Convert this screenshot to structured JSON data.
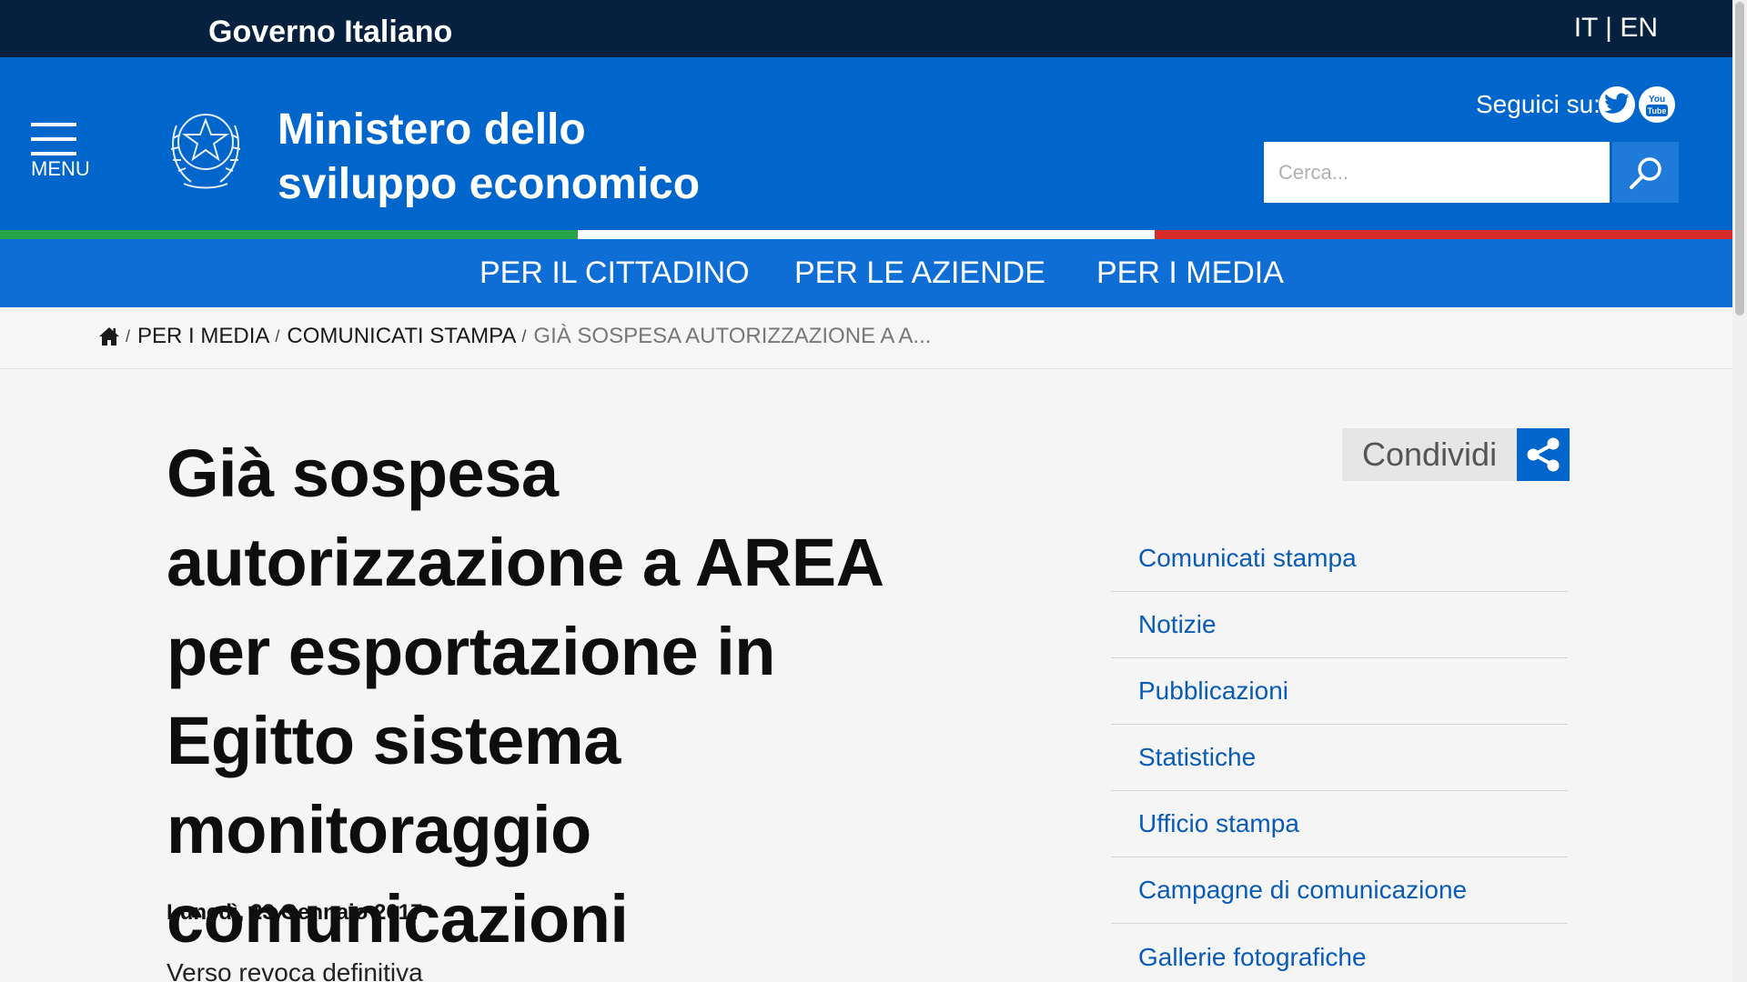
{
  "topbar": {
    "gov_label": "Governo Italiano",
    "lang_it": "IT",
    "lang_sep": " | ",
    "lang_en": "EN"
  },
  "header": {
    "menu_label": "MENU",
    "title_line1": "Ministero dello",
    "title_line2": "sviluppo economico",
    "follow_label": "Seguici su:",
    "search_placeholder": "Cerca...",
    "twitter_icon": "twitter-icon",
    "youtube_icon": "youtube-icon",
    "youtube_text_1": "You",
    "youtube_text_2": "Tube"
  },
  "colors": {
    "green": "#27a34a",
    "white": "#ffffff",
    "red": "#d62b2b",
    "brand": "#0066cc",
    "dark": "#06203f"
  },
  "nav": [
    {
      "label": "PER IL CITTADINO"
    },
    {
      "label": "PER LE AZIENDE"
    },
    {
      "label": "PER I MEDIA"
    }
  ],
  "breadcrumb": [
    {
      "label": "PER I MEDIA"
    },
    {
      "label": "COMUNICATI STAMPA"
    },
    {
      "label": "GIÀ SOSPESA AUTORIZZAZIONE A A..."
    }
  ],
  "article": {
    "title": "Già sospesa autorizzazione a AREA per esportazione in Egitto sistema monitoraggio comunicazioni",
    "date": "Lunedì, 23 Gennaio 2017",
    "lead": "Verso revoca definitiva"
  },
  "share": {
    "label": "Condividi"
  },
  "sidenav": [
    {
      "label": "Comunicati stampa"
    },
    {
      "label": "Notizie"
    },
    {
      "label": "Pubblicazioni"
    },
    {
      "label": "Statistiche"
    },
    {
      "label": "Ufficio stampa"
    },
    {
      "label": "Campagne di comunicazione"
    },
    {
      "label": "Gallerie fotografiche"
    }
  ]
}
